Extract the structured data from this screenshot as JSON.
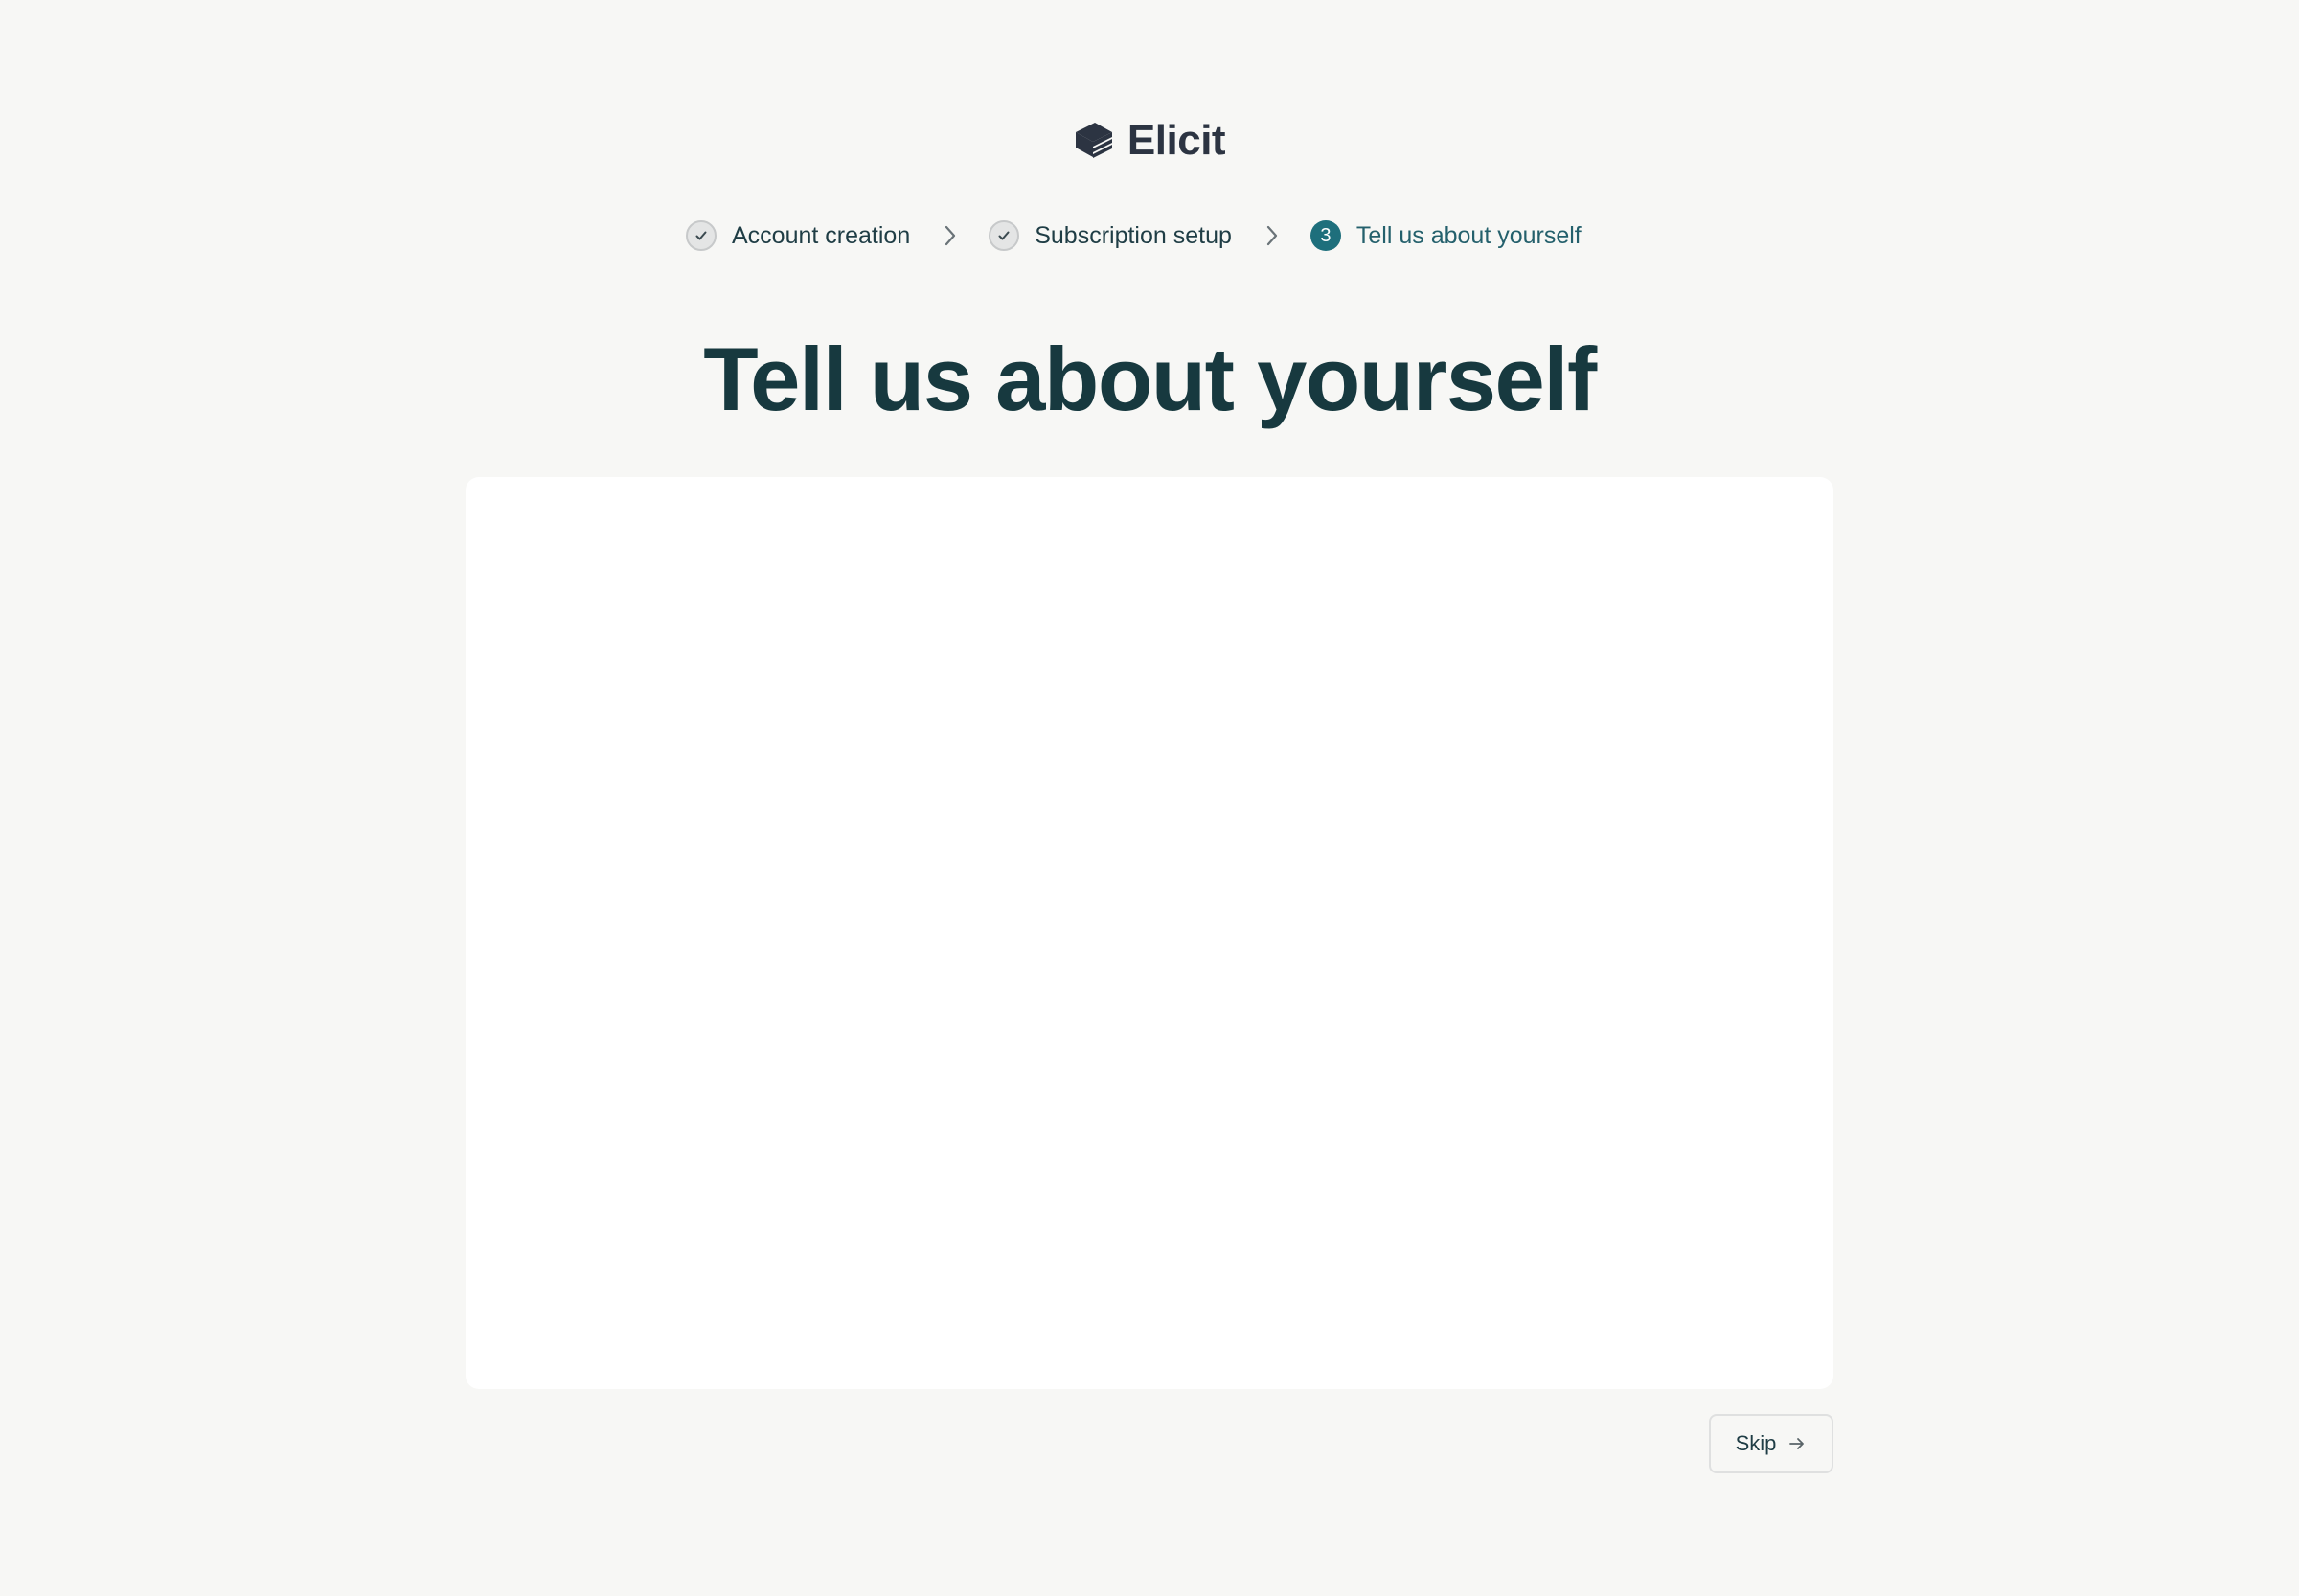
{
  "brand": {
    "name": "Elicit",
    "icon": "book-stack-logo-icon",
    "color": "#2c3442"
  },
  "steps": [
    {
      "label": "Account creation",
      "status": "complete",
      "icon": "checkmark-icon"
    },
    {
      "label": "Subscription setup",
      "status": "complete",
      "icon": "checkmark-icon"
    },
    {
      "label": "Tell us about yourself",
      "status": "current",
      "number": "3"
    }
  ],
  "step_separator_icon": "chevron-right-icon",
  "page": {
    "title": "Tell us about yourself"
  },
  "actions": {
    "skip_label": "Skip",
    "skip_icon": "arrow-right-icon"
  },
  "colors": {
    "background": "#f7f7f5",
    "accent": "#1e6f7c",
    "heading": "#17393f",
    "card": "#ffffff"
  }
}
